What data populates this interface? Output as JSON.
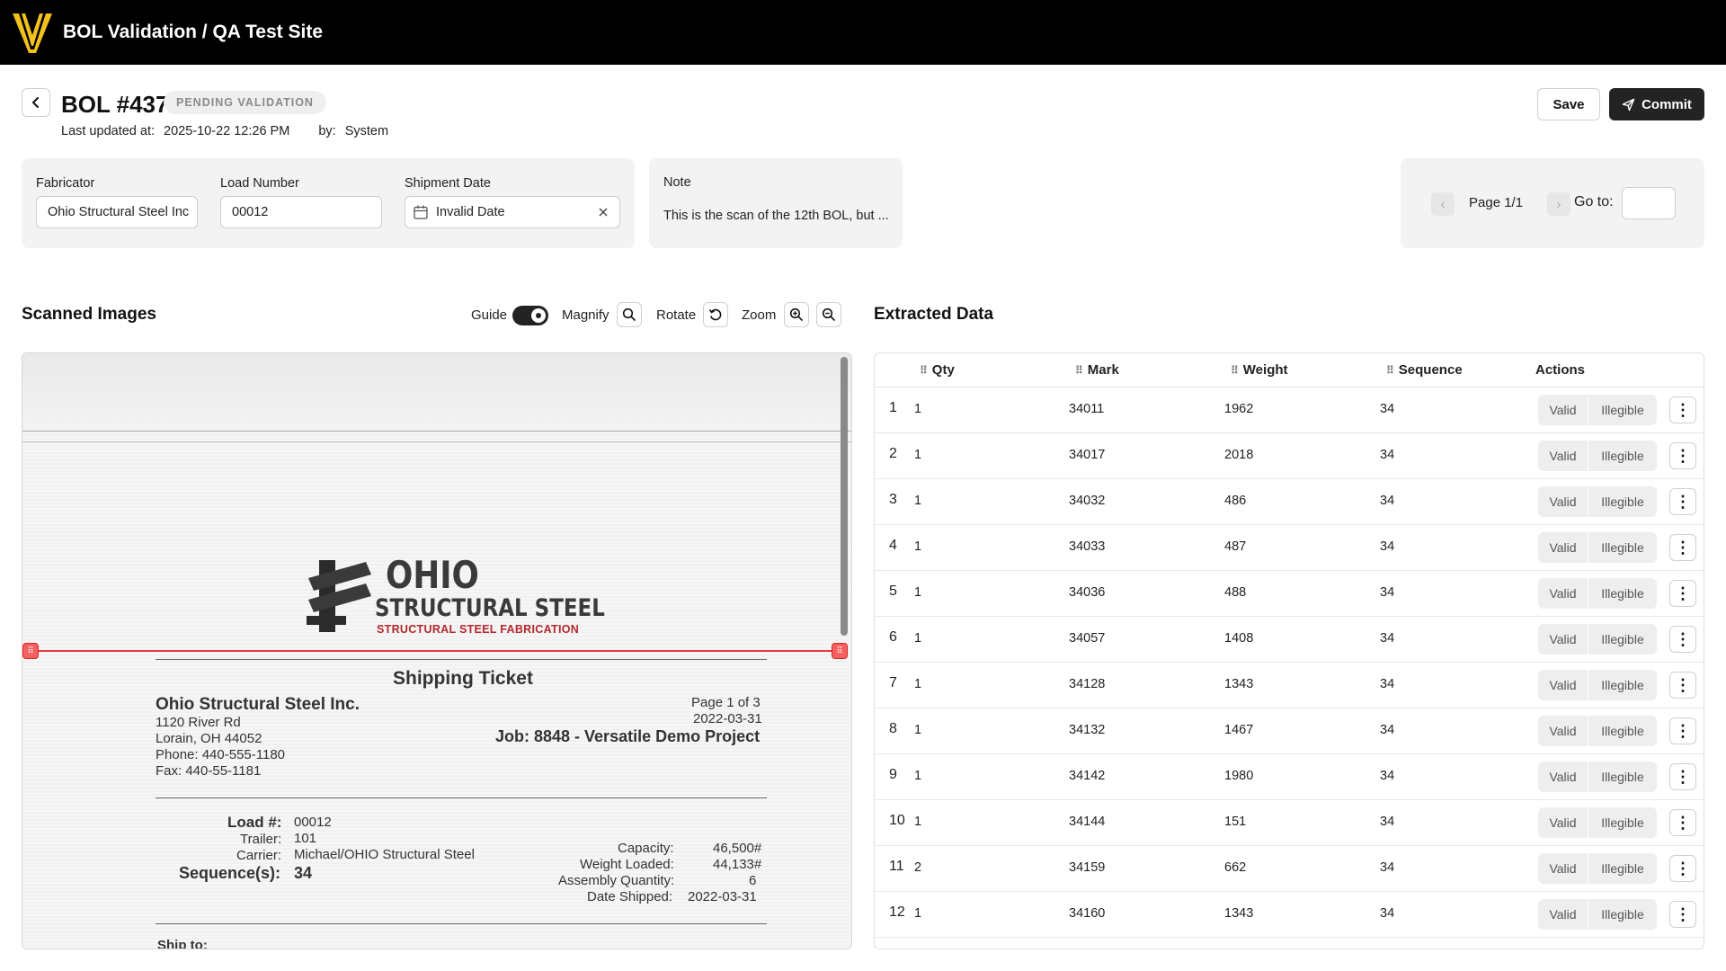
{
  "topbar": {
    "title": "BOL Validation / QA Test Site"
  },
  "header": {
    "bol_title": "BOL #437",
    "status": "PENDING VALIDATION",
    "updated_label": "Last updated at:",
    "updated_value": "2025-10-22 12:26 PM",
    "by_label": "by:",
    "by_value": "System",
    "save_label": "Save",
    "commit_label": "Commit"
  },
  "fields": {
    "fabricator_label": "Fabricator",
    "fabricator_value": "Ohio Structural Steel Inc",
    "load_label": "Load Number",
    "load_value": "00012",
    "date_label": "Shipment Date",
    "date_value": "Invalid Date"
  },
  "note": {
    "label": "Note",
    "text": "This is the scan of the 12th BOL, but ..."
  },
  "pager": {
    "page_text": "Page 1/1",
    "goto_label": "Go to:"
  },
  "scanned": {
    "title": "Scanned Images",
    "guide_label": "Guide",
    "guide_on": true,
    "magnify_label": "Magnify",
    "rotate_label": "Rotate",
    "zoom_label": "Zoom"
  },
  "document": {
    "logo_line1": "OHIO",
    "logo_line2": "STRUCTURAL STEEL",
    "logo_line3": "STRUCTURAL STEEL FABRICATION",
    "heading": "Shipping Ticket",
    "company": "Ohio Structural Steel Inc.",
    "address1": "1120 River Rd",
    "address2": "Lorain, OH 44052",
    "phone": "Phone: 440-555-1180",
    "fax": "Fax: 440-55-1181",
    "page": "Page 1 of 3",
    "date": "2022-03-31",
    "job": "Job: 8848 - Versatile Demo Project",
    "load_label": "Load #:",
    "load_value": "00012",
    "trailer_label": "Trailer:",
    "trailer_value": "101",
    "carrier_label": "Carrier:",
    "carrier_value": "Michael/OHIO Structural Steel",
    "sequence_label": "Sequence(s):",
    "sequence_value": "34",
    "capacity_label": "Capacity:",
    "capacity_value": "46,500#",
    "weight_label": "Weight Loaded:",
    "weight_value": "44,133#",
    "assembly_label": "Assembly Quantity:",
    "assembly_value": "6",
    "date_shipped_label": "Date Shipped:",
    "date_shipped_value": "2022-03-31",
    "ship_to": "Ship to:"
  },
  "extracted": {
    "title": "Extracted Data",
    "columns": [
      "Qty",
      "Mark",
      "Weight",
      "Sequence",
      "Actions"
    ],
    "valid_label": "Valid",
    "illegible_label": "Illegible",
    "rows": [
      {
        "n": "1",
        "qty": "1",
        "mark": "34011",
        "weight": "1962",
        "seq": "34"
      },
      {
        "n": "2",
        "qty": "1",
        "mark": "34017",
        "weight": "2018",
        "seq": "34"
      },
      {
        "n": "3",
        "qty": "1",
        "mark": "34032",
        "weight": "486",
        "seq": "34"
      },
      {
        "n": "4",
        "qty": "1",
        "mark": "34033",
        "weight": "487",
        "seq": "34"
      },
      {
        "n": "5",
        "qty": "1",
        "mark": "34036",
        "weight": "488",
        "seq": "34"
      },
      {
        "n": "6",
        "qty": "1",
        "mark": "34057",
        "weight": "1408",
        "seq": "34"
      },
      {
        "n": "7",
        "qty": "1",
        "mark": "34128",
        "weight": "1343",
        "seq": "34"
      },
      {
        "n": "8",
        "qty": "1",
        "mark": "34132",
        "weight": "1467",
        "seq": "34"
      },
      {
        "n": "9",
        "qty": "1",
        "mark": "34142",
        "weight": "1980",
        "seq": "34"
      },
      {
        "n": "10",
        "qty": "1",
        "mark": "34144",
        "weight": "151",
        "seq": "34"
      },
      {
        "n": "11",
        "qty": "2",
        "mark": "34159",
        "weight": "662",
        "seq": "34"
      },
      {
        "n": "12",
        "qty": "1",
        "mark": "34160",
        "weight": "1343",
        "seq": "34"
      }
    ]
  },
  "colors": {
    "topbar": "#000000",
    "logo": "#F2C21B",
    "commit": "#232323",
    "guide": "#E23B3B",
    "brand_red": "#B3282D"
  }
}
